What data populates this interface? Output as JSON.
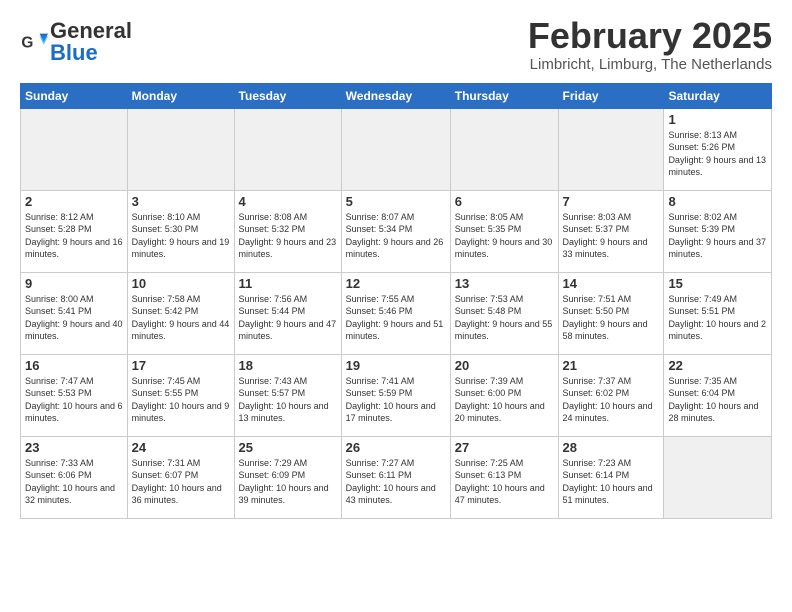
{
  "logo": {
    "general": "General",
    "blue": "Blue"
  },
  "header": {
    "title": "February 2025",
    "location": "Limbricht, Limburg, The Netherlands"
  },
  "weekdays": [
    "Sunday",
    "Monday",
    "Tuesday",
    "Wednesday",
    "Thursday",
    "Friday",
    "Saturday"
  ],
  "weeks": [
    [
      {
        "day": "",
        "info": "",
        "empty": true
      },
      {
        "day": "",
        "info": "",
        "empty": true
      },
      {
        "day": "",
        "info": "",
        "empty": true
      },
      {
        "day": "",
        "info": "",
        "empty": true
      },
      {
        "day": "",
        "info": "",
        "empty": true
      },
      {
        "day": "",
        "info": "",
        "empty": true
      },
      {
        "day": "1",
        "info": "Sunrise: 8:13 AM\nSunset: 5:26 PM\nDaylight: 9 hours and 13 minutes.",
        "empty": false
      }
    ],
    [
      {
        "day": "2",
        "info": "Sunrise: 8:12 AM\nSunset: 5:28 PM\nDaylight: 9 hours and 16 minutes.",
        "empty": false
      },
      {
        "day": "3",
        "info": "Sunrise: 8:10 AM\nSunset: 5:30 PM\nDaylight: 9 hours and 19 minutes.",
        "empty": false
      },
      {
        "day": "4",
        "info": "Sunrise: 8:08 AM\nSunset: 5:32 PM\nDaylight: 9 hours and 23 minutes.",
        "empty": false
      },
      {
        "day": "5",
        "info": "Sunrise: 8:07 AM\nSunset: 5:34 PM\nDaylight: 9 hours and 26 minutes.",
        "empty": false
      },
      {
        "day": "6",
        "info": "Sunrise: 8:05 AM\nSunset: 5:35 PM\nDaylight: 9 hours and 30 minutes.",
        "empty": false
      },
      {
        "day": "7",
        "info": "Sunrise: 8:03 AM\nSunset: 5:37 PM\nDaylight: 9 hours and 33 minutes.",
        "empty": false
      },
      {
        "day": "8",
        "info": "Sunrise: 8:02 AM\nSunset: 5:39 PM\nDaylight: 9 hours and 37 minutes.",
        "empty": false
      }
    ],
    [
      {
        "day": "9",
        "info": "Sunrise: 8:00 AM\nSunset: 5:41 PM\nDaylight: 9 hours and 40 minutes.",
        "empty": false
      },
      {
        "day": "10",
        "info": "Sunrise: 7:58 AM\nSunset: 5:42 PM\nDaylight: 9 hours and 44 minutes.",
        "empty": false
      },
      {
        "day": "11",
        "info": "Sunrise: 7:56 AM\nSunset: 5:44 PM\nDaylight: 9 hours and 47 minutes.",
        "empty": false
      },
      {
        "day": "12",
        "info": "Sunrise: 7:55 AM\nSunset: 5:46 PM\nDaylight: 9 hours and 51 minutes.",
        "empty": false
      },
      {
        "day": "13",
        "info": "Sunrise: 7:53 AM\nSunset: 5:48 PM\nDaylight: 9 hours and 55 minutes.",
        "empty": false
      },
      {
        "day": "14",
        "info": "Sunrise: 7:51 AM\nSunset: 5:50 PM\nDaylight: 9 hours and 58 minutes.",
        "empty": false
      },
      {
        "day": "15",
        "info": "Sunrise: 7:49 AM\nSunset: 5:51 PM\nDaylight: 10 hours and 2 minutes.",
        "empty": false
      }
    ],
    [
      {
        "day": "16",
        "info": "Sunrise: 7:47 AM\nSunset: 5:53 PM\nDaylight: 10 hours and 6 minutes.",
        "empty": false
      },
      {
        "day": "17",
        "info": "Sunrise: 7:45 AM\nSunset: 5:55 PM\nDaylight: 10 hours and 9 minutes.",
        "empty": false
      },
      {
        "day": "18",
        "info": "Sunrise: 7:43 AM\nSunset: 5:57 PM\nDaylight: 10 hours and 13 minutes.",
        "empty": false
      },
      {
        "day": "19",
        "info": "Sunrise: 7:41 AM\nSunset: 5:59 PM\nDaylight: 10 hours and 17 minutes.",
        "empty": false
      },
      {
        "day": "20",
        "info": "Sunrise: 7:39 AM\nSunset: 6:00 PM\nDaylight: 10 hours and 20 minutes.",
        "empty": false
      },
      {
        "day": "21",
        "info": "Sunrise: 7:37 AM\nSunset: 6:02 PM\nDaylight: 10 hours and 24 minutes.",
        "empty": false
      },
      {
        "day": "22",
        "info": "Sunrise: 7:35 AM\nSunset: 6:04 PM\nDaylight: 10 hours and 28 minutes.",
        "empty": false
      }
    ],
    [
      {
        "day": "23",
        "info": "Sunrise: 7:33 AM\nSunset: 6:06 PM\nDaylight: 10 hours and 32 minutes.",
        "empty": false
      },
      {
        "day": "24",
        "info": "Sunrise: 7:31 AM\nSunset: 6:07 PM\nDaylight: 10 hours and 36 minutes.",
        "empty": false
      },
      {
        "day": "25",
        "info": "Sunrise: 7:29 AM\nSunset: 6:09 PM\nDaylight: 10 hours and 39 minutes.",
        "empty": false
      },
      {
        "day": "26",
        "info": "Sunrise: 7:27 AM\nSunset: 6:11 PM\nDaylight: 10 hours and 43 minutes.",
        "empty": false
      },
      {
        "day": "27",
        "info": "Sunrise: 7:25 AM\nSunset: 6:13 PM\nDaylight: 10 hours and 47 minutes.",
        "empty": false
      },
      {
        "day": "28",
        "info": "Sunrise: 7:23 AM\nSunset: 6:14 PM\nDaylight: 10 hours and 51 minutes.",
        "empty": false
      },
      {
        "day": "",
        "info": "",
        "empty": true
      }
    ]
  ]
}
